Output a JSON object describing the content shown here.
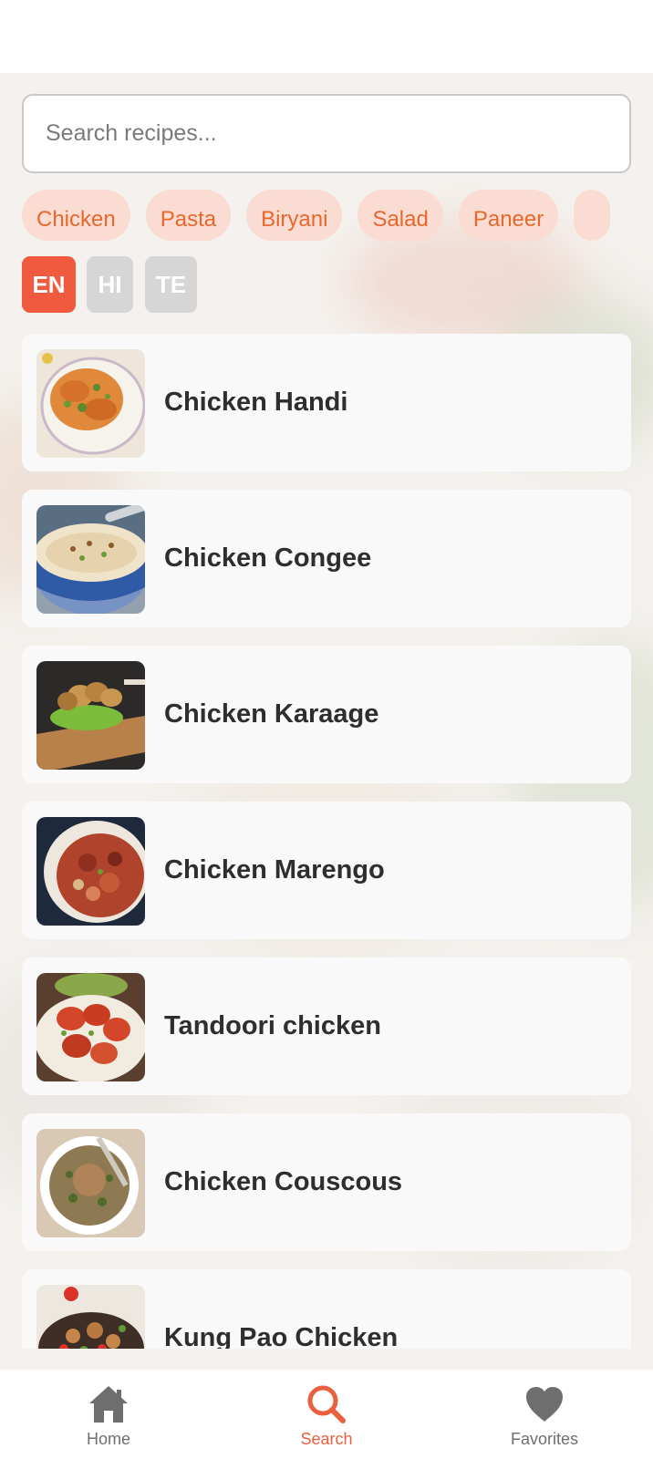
{
  "search": {
    "placeholder": "Search recipes..."
  },
  "categories": [
    "Chicken",
    "Pasta",
    "Biryani",
    "Salad",
    "Paneer"
  ],
  "languages": [
    {
      "code": "EN",
      "active": true
    },
    {
      "code": "HI",
      "active": false
    },
    {
      "code": "TE",
      "active": false
    }
  ],
  "recipes": [
    {
      "name": "Chicken Handi"
    },
    {
      "name": "Chicken Congee"
    },
    {
      "name": "Chicken Karaage"
    },
    {
      "name": "Chicken Marengo"
    },
    {
      "name": "Tandoori chicken"
    },
    {
      "name": "Chicken Couscous"
    },
    {
      "name": "Kung Pao Chicken"
    }
  ],
  "nav": {
    "home": {
      "label": "Home",
      "icon": "home-icon"
    },
    "search": {
      "label": "Search",
      "icon": "search-icon",
      "active": true
    },
    "favorites": {
      "label": "Favorites",
      "icon": "heart-icon"
    }
  },
  "colors": {
    "accent": "#e9603f",
    "chip_bg": "#fbdcd3",
    "chip_text": "#e8672c",
    "lang_inactive": "#d6d6d6",
    "nav_inactive": "#6e6e6e"
  }
}
